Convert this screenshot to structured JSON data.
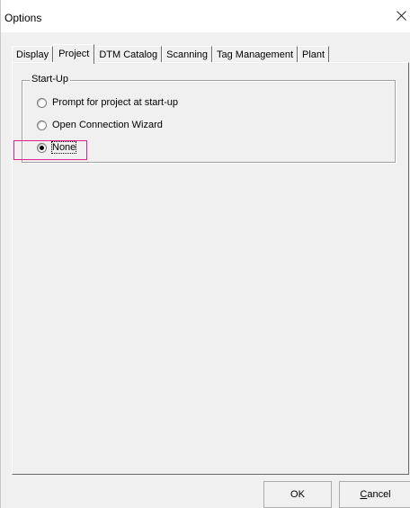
{
  "window": {
    "title": "Options",
    "close_glyph": "close-icon"
  },
  "tabs": [
    {
      "label": "Display",
      "active": false
    },
    {
      "label": "Project",
      "active": true
    },
    {
      "label": "DTM Catalog",
      "active": false
    },
    {
      "label": "Scanning",
      "active": false
    },
    {
      "label": "Tag Management",
      "active": false
    },
    {
      "label": "Plant",
      "active": false
    }
  ],
  "startup_group": {
    "legend": "Start-Up",
    "options": [
      {
        "label": "Prompt for project at start-up",
        "checked": false
      },
      {
        "label": "Open Connection Wizard",
        "checked": false
      },
      {
        "label": "None",
        "checked": true
      }
    ]
  },
  "buttons": {
    "ok_label": "OK",
    "cancel_mnemonic": "C",
    "cancel_rest": "ancel"
  },
  "colors": {
    "highlight": "#e0218a",
    "dialog_bg": "#f0f0f0"
  }
}
